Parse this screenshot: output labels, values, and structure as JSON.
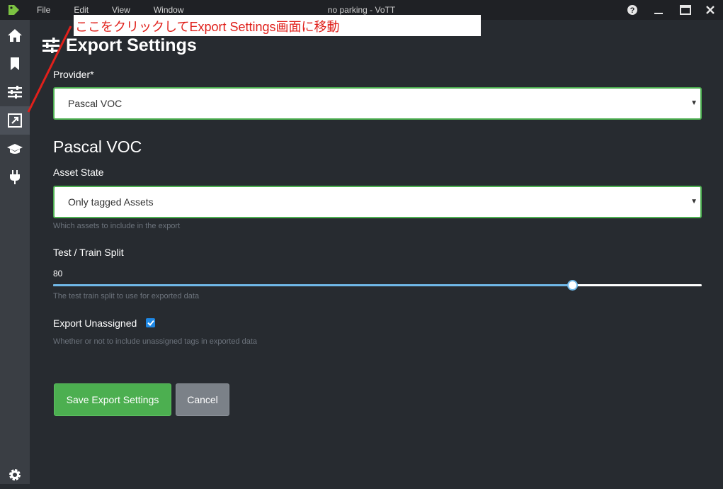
{
  "titlebar": {
    "menu": [
      "File",
      "Edit",
      "View",
      "Window"
    ],
    "title": "no parking - VoTT",
    "controls": [
      "help-icon",
      "minimize-icon",
      "maximize-icon",
      "close-icon"
    ]
  },
  "sidebar": {
    "items": [
      {
        "name": "home",
        "icon": "home-icon",
        "active": false
      },
      {
        "name": "bookmark",
        "icon": "bookmark-icon",
        "active": false
      },
      {
        "name": "settings",
        "icon": "sliders-icon",
        "active": false
      },
      {
        "name": "export",
        "icon": "export-icon",
        "active": true
      },
      {
        "name": "train",
        "icon": "graduation-cap-icon",
        "active": false
      },
      {
        "name": "connections",
        "icon": "plug-icon",
        "active": false
      }
    ],
    "bottom_icon": "gear-icon"
  },
  "page": {
    "title": "Export Settings",
    "provider_label": "Provider*",
    "provider_value": "Pascal VOC",
    "section_title": "Pascal VOC",
    "asset_state_label": "Asset State",
    "asset_state_value": "Only tagged Assets",
    "asset_state_help": "Which assets to include in the export",
    "split_label": "Test / Train Split",
    "split_value": "80",
    "split_fraction": 0.8,
    "split_help": "The test train split to use for exported data",
    "unassigned_label": "Export Unassigned",
    "unassigned_checked": true,
    "unassigned_help": "Whether or not to include unassigned tags in exported data",
    "save_label": "Save Export Settings",
    "cancel_label": "Cancel"
  },
  "annotation": {
    "text": "ここをクリックしてExport Settings画面に移動",
    "color": "#e0201b"
  },
  "colors": {
    "accent_green": "#4caf50",
    "slider_blue": "#70b8e8",
    "checkbox_blue": "#1e88e5",
    "background": "#272b30"
  }
}
